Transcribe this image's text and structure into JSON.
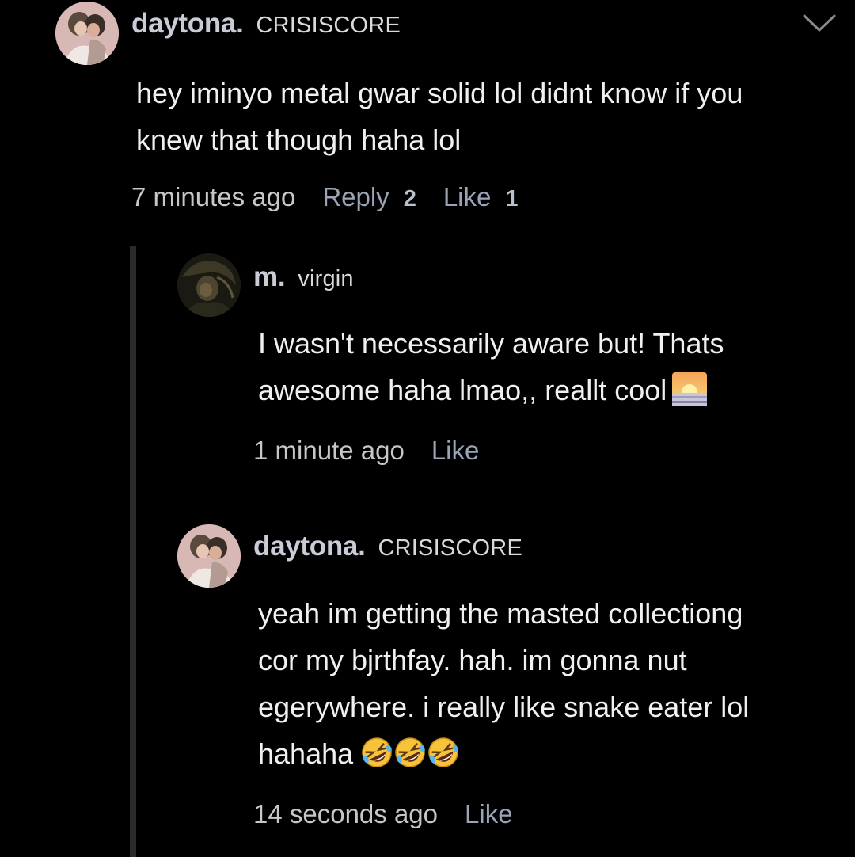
{
  "comments": [
    {
      "username": "daytona.",
      "flair": "CRISISCORE",
      "avatar": "avatar-couple-pink",
      "text": "hey iminyo metal gwar solid lol didnt know if you\nknew that though haha lol",
      "timestamp": "7 minutes ago",
      "reply_label": "Reply",
      "reply_count": "2",
      "like_label": "Like",
      "like_count": "1",
      "collapse_icon": "chevron-down-icon"
    }
  ],
  "replies": [
    {
      "username": "m.",
      "flair": "virgin",
      "avatar": "avatar-dark-figure",
      "text": "I wasn't necessarily aware but! Thats\nawesome haha lmao,, reallt cool",
      "emoji": "sunrise-emoji",
      "timestamp": "1 minute ago",
      "like_label": "Like"
    },
    {
      "username": "daytona.",
      "flair": "CRISISCORE",
      "avatar": "avatar-couple-pink",
      "text": "yeah im getting the masted collectiong\ncor my bjrthfay. hah. im gonna nut\negerywhere. i really like snake eater lol\nhahaha",
      "emoji": "rolling-on-floor-laughing-emoji",
      "emoji_count": 3,
      "timestamp": "14 seconds ago",
      "like_label": "Like"
    }
  ],
  "colors": {
    "background": "#000000",
    "username": "#c9ccd6",
    "action": "#9aa4b6",
    "text": "#f0f0f0",
    "thread_line": "#2b2b2b"
  }
}
